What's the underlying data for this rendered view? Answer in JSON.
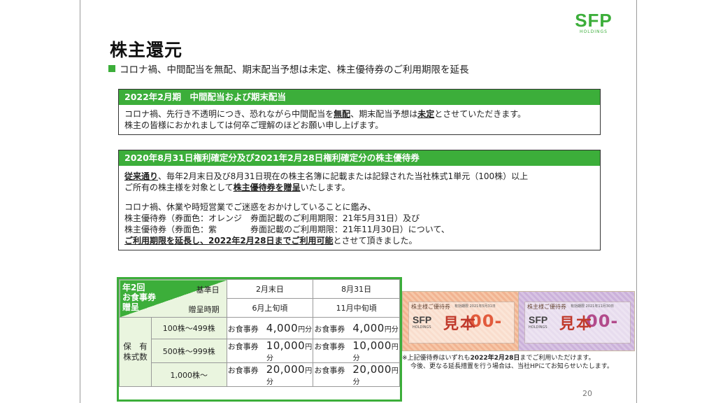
{
  "logo": {
    "mark": "SFP",
    "sub": "HOLDINGS"
  },
  "title": "株主還元",
  "subtitle": "コロナ禍、中間配当を無配、期末配当予想は未定、株主優待券のご利用期限を延長",
  "dividend": {
    "heading": "2022年2月期　中間配当および期末配当",
    "l1_a": "コロナ禍、先行き不透明につき、恐れながら中間配当を",
    "l1_b": "無配",
    "l1_c": "、期末配当予想は",
    "l1_d": "未定",
    "l1_e": "とさせていただきます。",
    "l2": "株主の皆様におかれましては何卒ご理解のほどお願い申し上げます。"
  },
  "benefit": {
    "heading": "2020年8月31日権利確定分及び2021年2月28日権利確定分の株主優待券",
    "p1_a": "従来通り",
    "p1_b": "、毎年2月末日及び8月31日現在の株主名簿に記載または記録された当社株式1単元（100株）以上",
    "p2_a": "ご所有の株主様を対象として",
    "p2_b": "株主優待券を贈呈",
    "p2_c": "いたします。",
    "p3": "コロナ禍、休業や時短営業でご迷惑をおかけしていることに鑑み、",
    "p4": "株主優待券（券面色：オレンジ　券面記載のご利用期限：21年5月31日）及び",
    "p5": "株主優待券（券面色：紫　　　　券面記載のご利用期限：21年11月30日）について、",
    "p6_a": "ご利用期限を延長し、2022年2月28日までご利用可能",
    "p6_b": "とさせて頂きました。"
  },
  "table": {
    "corner": "年2回\nお食事券\n贈呈",
    "kijunbi_label": "基準日",
    "zotei_label": "贈呈時期",
    "col1": "2月末日",
    "col2": "8月31日",
    "col1_time": "6月上旬頃",
    "col2_time": "11月中旬頃",
    "side_label": "保　有\n株式数",
    "rows": [
      {
        "range": "100株～499株",
        "lbl": "お食事券",
        "v1": "4,000",
        "v2": "4,000",
        "unit": "円分"
      },
      {
        "range": "500株～999株",
        "lbl": "お食事券",
        "v1": "10,000",
        "v2": "10,000",
        "unit": "円分"
      },
      {
        "range": "1,000株～",
        "lbl": "お食事券",
        "v1": "20,000",
        "v2": "20,000",
        "unit": "円分"
      }
    ]
  },
  "vouchers": [
    {
      "head": "株主様ご優待券",
      "date": "有効期限 2021年5月31日",
      "logo": "SFP",
      "logo_sub": "HOLDINGS",
      "amount": "00-",
      "stamp": "見本"
    },
    {
      "head": "株主様ご優待券",
      "date": "有効期限 2021年11月30日",
      "logo": "SFP",
      "logo_sub": "HOLDINGS",
      "amount": "00-",
      "stamp": "見本"
    }
  ],
  "note": {
    "l1_a": "※上記優待券はいずれも",
    "l1_b": "2022年2月28日",
    "l1_c": "までご利用いただけます。",
    "l2": "今後、更なる延長措置を行う場合は、当社HPにてお知らせいたします。"
  },
  "page_number": "20",
  "colors": {
    "accent": "#3cae3a",
    "orange_voucher": "#f1b391",
    "purple_voucher": "#cbb1da"
  }
}
